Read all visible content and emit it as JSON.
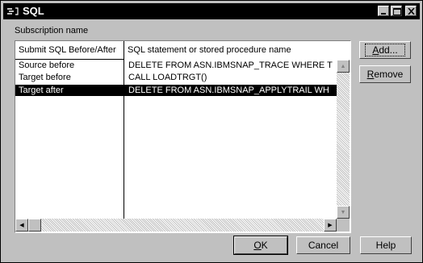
{
  "window": {
    "title": "SQL",
    "min_glyph": "_",
    "max_glyph": "□",
    "close_glyph": "✕"
  },
  "label": {
    "subscription": "Subscription name"
  },
  "table": {
    "columns": [
      "Submit SQL Before/After",
      "SQL statement or stored procedure name"
    ],
    "rows": [
      {
        "when": "Source before",
        "sql": "DELETE FROM ASN.IBMSNAP_TRACE WHERE T",
        "selected": false
      },
      {
        "when": "Target before",
        "sql": "CALL LOADTRGT()",
        "selected": false
      },
      {
        "when": "Target after",
        "sql": "DELETE FROM ASN.IBMSNAP_APPLYTRAIL WH",
        "selected": true
      }
    ]
  },
  "buttons": {
    "add": {
      "pre": "",
      "key": "A",
      "post": "dd..."
    },
    "remove": {
      "pre": "",
      "key": "R",
      "post": "emove"
    },
    "ok": {
      "pre": "",
      "key": "O",
      "post": "K"
    },
    "cancel": "Cancel",
    "help": "Help"
  },
  "scroll": {
    "up": "▲",
    "down": "▼",
    "left": "◀",
    "right": "▶"
  }
}
